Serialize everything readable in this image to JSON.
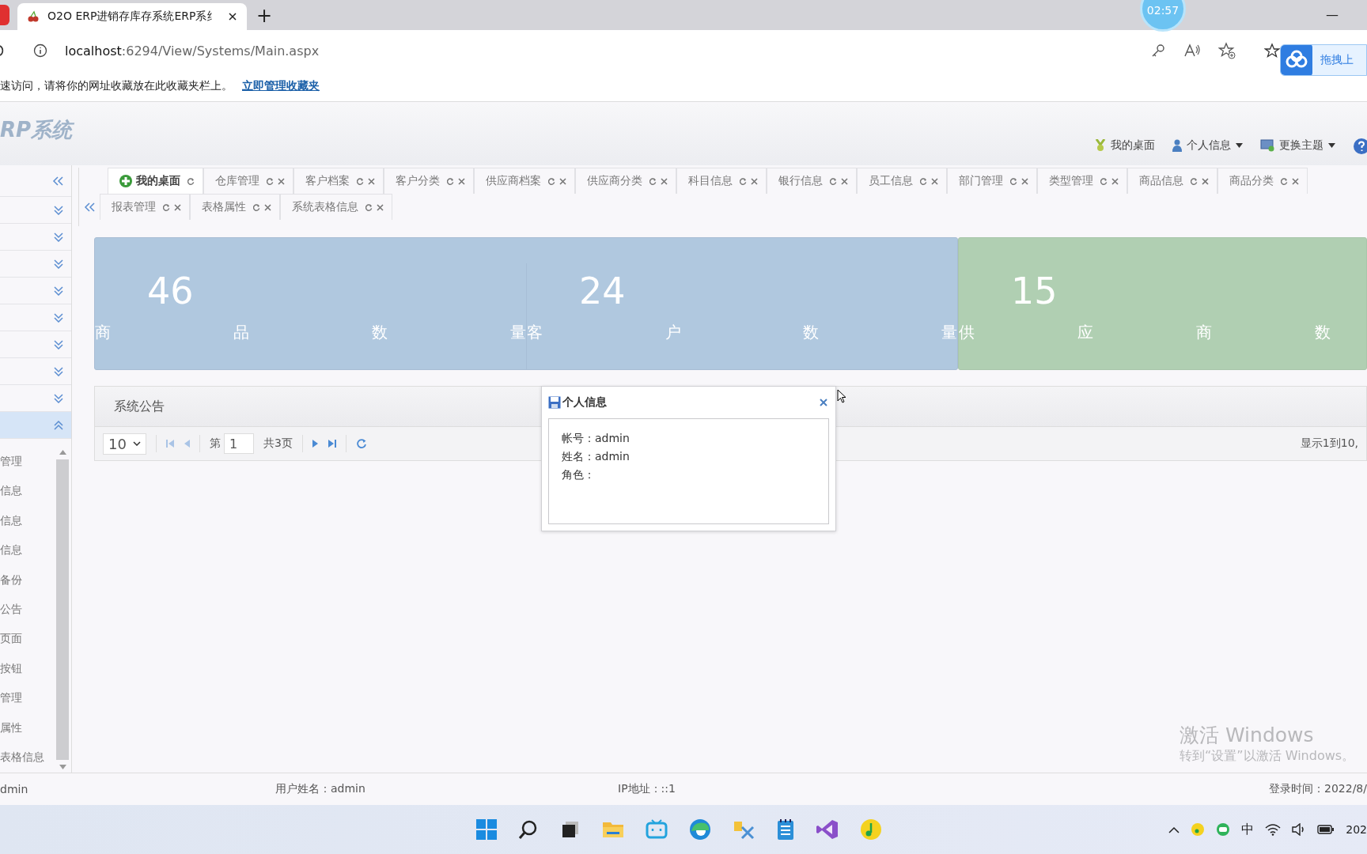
{
  "browser": {
    "tab_title": "O2O ERP进销存库存系统ERP系纟",
    "new_tab": "+",
    "timer": "02:57",
    "minimize": "—",
    "url_host": "localhost",
    "url_path": ":6294/View/Systems/Main.aspx",
    "upload_button": "拖拽上",
    "favorites_hint": "速访问，请将你的网址收藏放在此收藏夹栏上。",
    "favorites_link": "立即管理收藏夹"
  },
  "header": {
    "logo": "RP系统",
    "menu": [
      {
        "kind": "plain",
        "label": "我的桌面"
      },
      {
        "kind": "dropdown",
        "label": "个人信息"
      },
      {
        "kind": "dropdown",
        "label": "更换主题"
      }
    ]
  },
  "sidebar": {
    "groups": [
      {
        "expanded": false
      },
      {
        "expanded": false
      },
      {
        "expanded": false
      },
      {
        "expanded": false
      },
      {
        "expanded": false
      },
      {
        "expanded": false
      },
      {
        "expanded": false
      },
      {
        "expanded": false
      },
      {
        "expanded": true
      }
    ],
    "items": [
      "管理",
      "信息",
      "信息",
      "信息",
      "备份",
      "公告",
      "页面",
      "按钮",
      "管理",
      "属性",
      "表格信息"
    ]
  },
  "tab_rows": [
    [
      {
        "label": "我的桌面",
        "selected": true,
        "closable": false
      },
      {
        "label": "仓库管理",
        "selected": false,
        "closable": true
      },
      {
        "label": "客户档案",
        "selected": false,
        "closable": true
      },
      {
        "label": "客户分类",
        "selected": false,
        "closable": true
      },
      {
        "label": "供应商档案",
        "selected": false,
        "closable": true
      },
      {
        "label": "供应商分类",
        "selected": false,
        "closable": true
      },
      {
        "label": "科目信息",
        "selected": false,
        "closable": true
      },
      {
        "label": "银行信息",
        "selected": false,
        "closable": true
      },
      {
        "label": "员工信息",
        "selected": false,
        "closable": true
      },
      {
        "label": "部门管理",
        "selected": false,
        "closable": true
      },
      {
        "label": "类型管理",
        "selected": false,
        "closable": true
      },
      {
        "label": "商品信息",
        "selected": false,
        "closable": true
      },
      {
        "label": "商品分类",
        "selected": false,
        "closable": true
      }
    ],
    [
      {
        "label": "报表管理",
        "selected": false,
        "closable": true
      },
      {
        "label": "表格属性",
        "selected": false,
        "closable": true
      },
      {
        "label": "系统表格信息",
        "selected": false,
        "closable": true
      }
    ]
  ],
  "stat_groups": [
    {
      "color": "#b0c8df",
      "stats": [
        {
          "value": "46",
          "label": "商品数量"
        },
        {
          "value": "24",
          "label": "客户数量"
        }
      ]
    },
    {
      "color": "#b0cfb2",
      "stats": [
        {
          "value": "15",
          "label": "供应商数"
        }
      ]
    }
  ],
  "notice": {
    "title": "系统公告",
    "page_size": "10",
    "page_prefix": "第",
    "page": "1",
    "page_total": "共3页",
    "range": "显示1到10,"
  },
  "dialog": {
    "title": "个人信息",
    "fields": [
      "帐号：admin",
      "姓名：admin",
      "角色："
    ]
  },
  "status_bar": [
    "dmin",
    "用户姓名：admin",
    "IP地址：::1",
    "登录时间：2022/8/"
  ],
  "watermark": {
    "title": "激活 Windows",
    "subtitle": "转到“设置”以激活 Windows。"
  },
  "taskbar": {
    "ime": "中",
    "clock": "202"
  }
}
